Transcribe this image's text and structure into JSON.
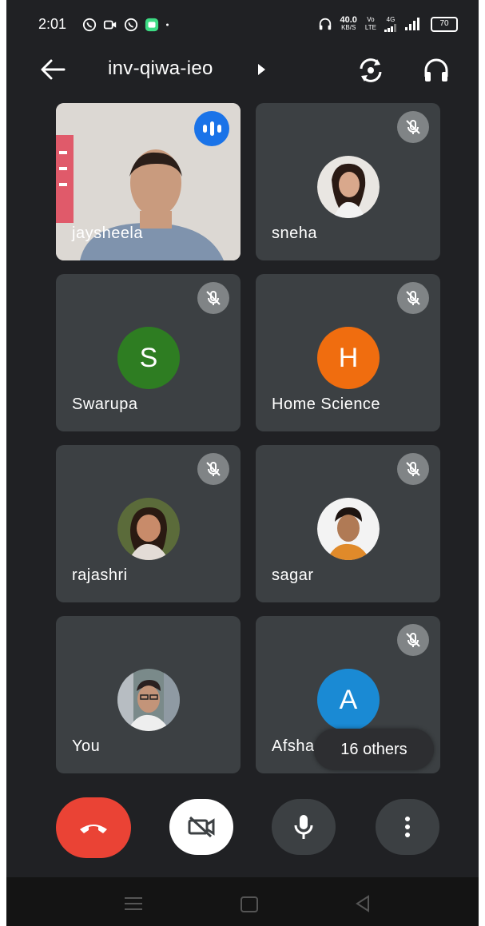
{
  "status_bar": {
    "time": "2:01",
    "net_speed": "40.0",
    "net_unit": "KB/S",
    "volte_top": "Vo",
    "volte_bottom": "LTE",
    "network": "4G",
    "battery": "70"
  },
  "header": {
    "meeting_code": "inv-qiwa-ieo"
  },
  "participants": [
    {
      "name": "jaysheela",
      "type": "video",
      "speaking": true
    },
    {
      "name": "sneha",
      "type": "photo",
      "muted": true
    },
    {
      "name": "Swarupa",
      "type": "initial",
      "initial": "S",
      "color": "#2e7d22",
      "muted": true
    },
    {
      "name": "Home Science",
      "type": "initial",
      "initial": "H",
      "color": "#f06d0f",
      "muted": true
    },
    {
      "name": "rajashri",
      "type": "photo",
      "muted": true
    },
    {
      "name": "sagar",
      "type": "photo",
      "muted": true
    },
    {
      "name": "You",
      "type": "photo",
      "muted": false
    },
    {
      "name": "Afsha",
      "type": "initial",
      "initial": "A",
      "color": "#1a8ad4",
      "muted": true
    }
  ],
  "others_label": "16 others",
  "controls": {
    "end_call_icon": "phone-hangup-icon",
    "camera_icon": "video-off-icon",
    "mic_icon": "mic-icon",
    "more_icon": "more-vert-icon"
  },
  "colors": {
    "background": "#202124",
    "tile": "#3c4043",
    "end_call": "#ea4335",
    "speaking": "#1a73e8"
  }
}
